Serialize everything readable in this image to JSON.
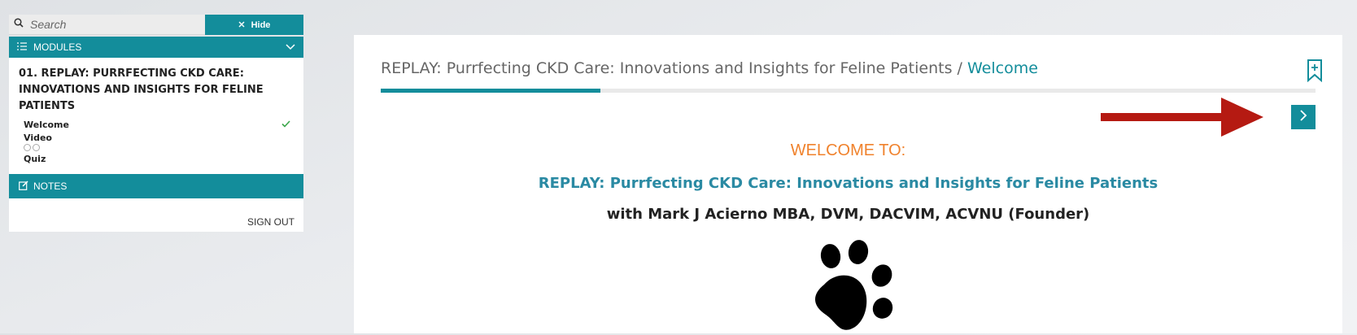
{
  "sidebar": {
    "search": {
      "placeholder": "Search",
      "value": ""
    },
    "hide_label": "Hide",
    "modules_label": "MODULES",
    "module": {
      "title": "01. REPLAY: PURRFECTING CKD CARE: INNOVATIONS AND INSIGHTS FOR FELINE PATIENTS",
      "lessons": [
        {
          "label": "Welcome",
          "status": "complete"
        },
        {
          "label": "Video",
          "status": "in-progress"
        },
        {
          "label": "Quiz",
          "status": "not-started"
        }
      ]
    },
    "notes_label": "NOTES",
    "signout_label": "SIGN OUT"
  },
  "main": {
    "breadcrumb": {
      "course": "REPLAY: Purrfecting CKD Care: Innovations and Insights for Feline Patients",
      "separator": "/",
      "current": "Welcome"
    },
    "progress_fraction": 0.235,
    "welcome_to": "WELCOME TO:",
    "course_title": "REPLAY: Purrfecting CKD Care: Innovations and Insights for Feline Patients",
    "instructor": "with Mark J Acierno MBA, DVM, DACVIM, ACVNU (Founder)"
  },
  "icons": {
    "search": "search-icon",
    "hide": "close-icon",
    "modules": "list-icon",
    "collapse": "chevron-down-icon",
    "complete": "checkmark-icon",
    "notes": "edit-icon",
    "bookmark": "bookmark-plus-icon",
    "next": "chevron-right-icon",
    "paw": "paw-print-icon"
  },
  "colors": {
    "accent": "#138d9b",
    "welcome": "#f0822c",
    "title": "#2a8aa3",
    "check": "#3aa64a",
    "annotation_arrow": "#b51a12"
  }
}
